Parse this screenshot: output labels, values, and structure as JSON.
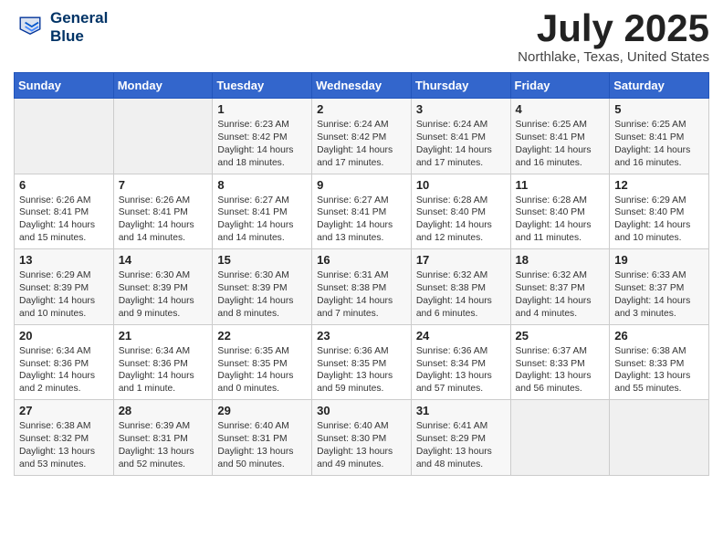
{
  "header": {
    "logo_line1": "General",
    "logo_line2": "Blue",
    "month_title": "July 2025",
    "location": "Northlake, Texas, United States"
  },
  "weekdays": [
    "Sunday",
    "Monday",
    "Tuesday",
    "Wednesday",
    "Thursday",
    "Friday",
    "Saturday"
  ],
  "weeks": [
    [
      {
        "day": "",
        "content": ""
      },
      {
        "day": "",
        "content": ""
      },
      {
        "day": "1",
        "content": "Sunrise: 6:23 AM\nSunset: 8:42 PM\nDaylight: 14 hours and 18 minutes."
      },
      {
        "day": "2",
        "content": "Sunrise: 6:24 AM\nSunset: 8:42 PM\nDaylight: 14 hours and 17 minutes."
      },
      {
        "day": "3",
        "content": "Sunrise: 6:24 AM\nSunset: 8:41 PM\nDaylight: 14 hours and 17 minutes."
      },
      {
        "day": "4",
        "content": "Sunrise: 6:25 AM\nSunset: 8:41 PM\nDaylight: 14 hours and 16 minutes."
      },
      {
        "day": "5",
        "content": "Sunrise: 6:25 AM\nSunset: 8:41 PM\nDaylight: 14 hours and 16 minutes."
      }
    ],
    [
      {
        "day": "6",
        "content": "Sunrise: 6:26 AM\nSunset: 8:41 PM\nDaylight: 14 hours and 15 minutes."
      },
      {
        "day": "7",
        "content": "Sunrise: 6:26 AM\nSunset: 8:41 PM\nDaylight: 14 hours and 14 minutes."
      },
      {
        "day": "8",
        "content": "Sunrise: 6:27 AM\nSunset: 8:41 PM\nDaylight: 14 hours and 14 minutes."
      },
      {
        "day": "9",
        "content": "Sunrise: 6:27 AM\nSunset: 8:41 PM\nDaylight: 14 hours and 13 minutes."
      },
      {
        "day": "10",
        "content": "Sunrise: 6:28 AM\nSunset: 8:40 PM\nDaylight: 14 hours and 12 minutes."
      },
      {
        "day": "11",
        "content": "Sunrise: 6:28 AM\nSunset: 8:40 PM\nDaylight: 14 hours and 11 minutes."
      },
      {
        "day": "12",
        "content": "Sunrise: 6:29 AM\nSunset: 8:40 PM\nDaylight: 14 hours and 10 minutes."
      }
    ],
    [
      {
        "day": "13",
        "content": "Sunrise: 6:29 AM\nSunset: 8:39 PM\nDaylight: 14 hours and 10 minutes."
      },
      {
        "day": "14",
        "content": "Sunrise: 6:30 AM\nSunset: 8:39 PM\nDaylight: 14 hours and 9 minutes."
      },
      {
        "day": "15",
        "content": "Sunrise: 6:30 AM\nSunset: 8:39 PM\nDaylight: 14 hours and 8 minutes."
      },
      {
        "day": "16",
        "content": "Sunrise: 6:31 AM\nSunset: 8:38 PM\nDaylight: 14 hours and 7 minutes."
      },
      {
        "day": "17",
        "content": "Sunrise: 6:32 AM\nSunset: 8:38 PM\nDaylight: 14 hours and 6 minutes."
      },
      {
        "day": "18",
        "content": "Sunrise: 6:32 AM\nSunset: 8:37 PM\nDaylight: 14 hours and 4 minutes."
      },
      {
        "day": "19",
        "content": "Sunrise: 6:33 AM\nSunset: 8:37 PM\nDaylight: 14 hours and 3 minutes."
      }
    ],
    [
      {
        "day": "20",
        "content": "Sunrise: 6:34 AM\nSunset: 8:36 PM\nDaylight: 14 hours and 2 minutes."
      },
      {
        "day": "21",
        "content": "Sunrise: 6:34 AM\nSunset: 8:36 PM\nDaylight: 14 hours and 1 minute."
      },
      {
        "day": "22",
        "content": "Sunrise: 6:35 AM\nSunset: 8:35 PM\nDaylight: 14 hours and 0 minutes."
      },
      {
        "day": "23",
        "content": "Sunrise: 6:36 AM\nSunset: 8:35 PM\nDaylight: 13 hours and 59 minutes."
      },
      {
        "day": "24",
        "content": "Sunrise: 6:36 AM\nSunset: 8:34 PM\nDaylight: 13 hours and 57 minutes."
      },
      {
        "day": "25",
        "content": "Sunrise: 6:37 AM\nSunset: 8:33 PM\nDaylight: 13 hours and 56 minutes."
      },
      {
        "day": "26",
        "content": "Sunrise: 6:38 AM\nSunset: 8:33 PM\nDaylight: 13 hours and 55 minutes."
      }
    ],
    [
      {
        "day": "27",
        "content": "Sunrise: 6:38 AM\nSunset: 8:32 PM\nDaylight: 13 hours and 53 minutes."
      },
      {
        "day": "28",
        "content": "Sunrise: 6:39 AM\nSunset: 8:31 PM\nDaylight: 13 hours and 52 minutes."
      },
      {
        "day": "29",
        "content": "Sunrise: 6:40 AM\nSunset: 8:31 PM\nDaylight: 13 hours and 50 minutes."
      },
      {
        "day": "30",
        "content": "Sunrise: 6:40 AM\nSunset: 8:30 PM\nDaylight: 13 hours and 49 minutes."
      },
      {
        "day": "31",
        "content": "Sunrise: 6:41 AM\nSunset: 8:29 PM\nDaylight: 13 hours and 48 minutes."
      },
      {
        "day": "",
        "content": ""
      },
      {
        "day": "",
        "content": ""
      }
    ]
  ]
}
